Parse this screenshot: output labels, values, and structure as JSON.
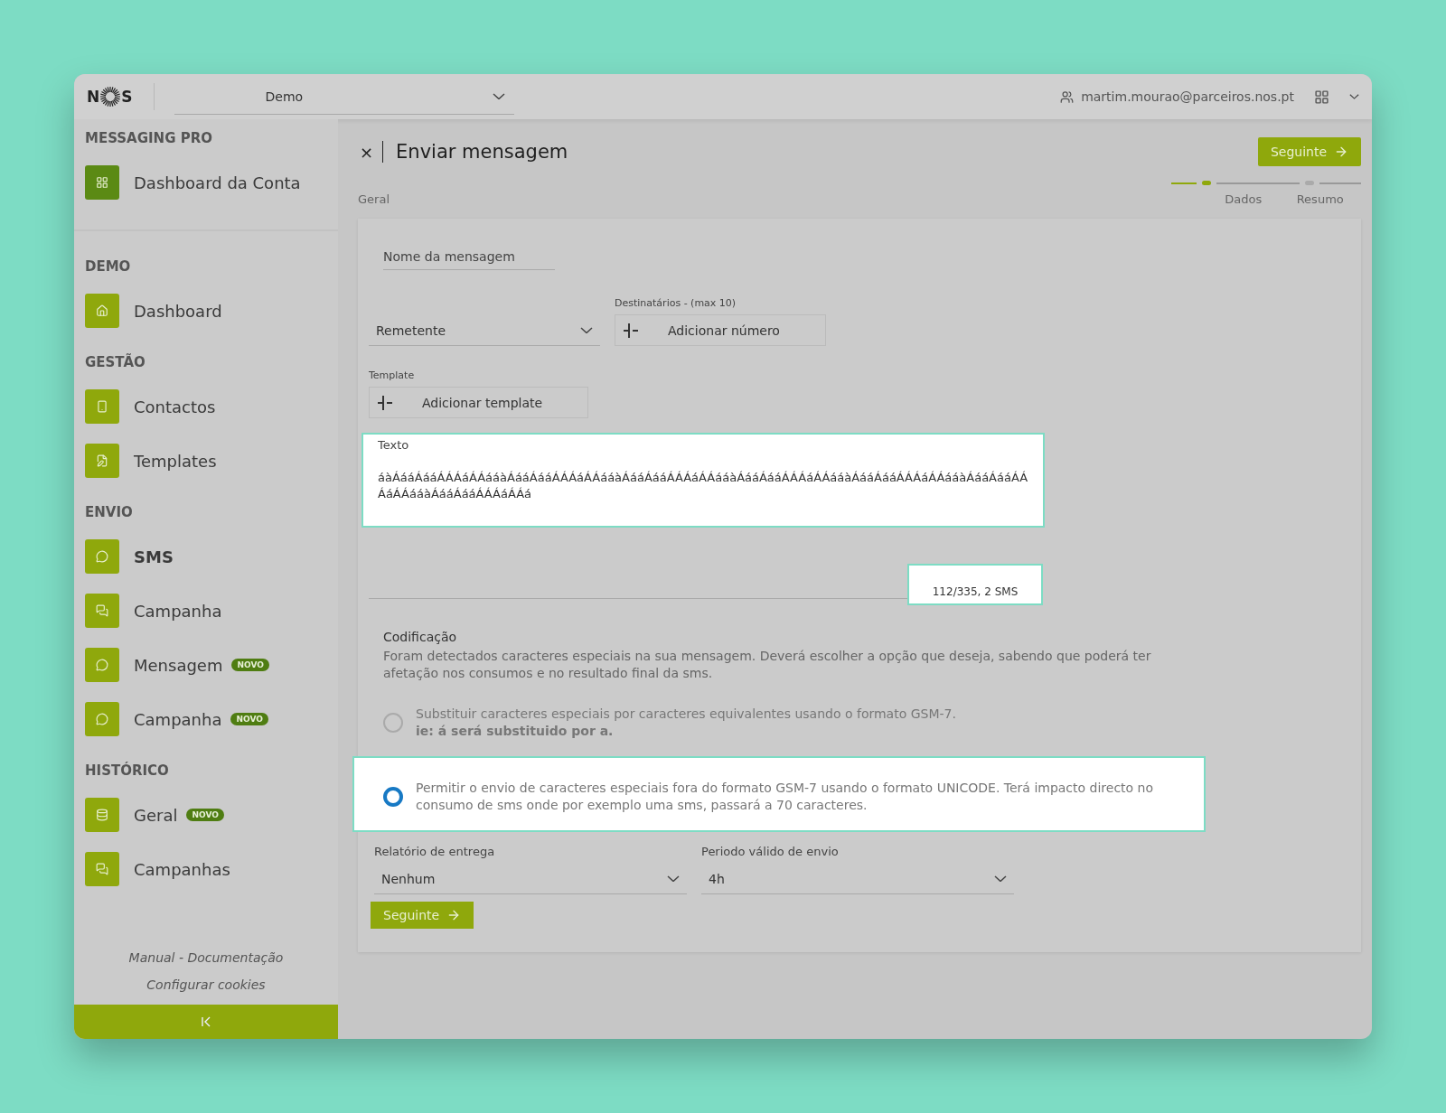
{
  "topbar": {
    "logo": {
      "left": "N",
      "right": "S"
    },
    "account_select": {
      "value": "Demo"
    },
    "user": "martim.mourao@parceiros.nos.pt"
  },
  "sidebar": {
    "sections": [
      {
        "title": "MESSAGING PRO",
        "kind": "account",
        "items": [
          {
            "label": "Dashboard da Conta",
            "selected": false
          }
        ]
      },
      {
        "title": "DEMO",
        "kind": "nav",
        "items": [
          {
            "label": "Dashboard",
            "selected": false
          }
        ]
      },
      {
        "title": "GESTÃO",
        "kind": "nav",
        "items": [
          {
            "label": "Contactos",
            "selected": false
          },
          {
            "label": "Templates",
            "selected": false
          }
        ]
      },
      {
        "title": "ENVIO",
        "kind": "nav",
        "items": [
          {
            "label": "SMS",
            "selected": true
          },
          {
            "label": "Campanha",
            "selected": false
          },
          {
            "label": "Mensagem",
            "badge": "NOVO",
            "selected": false
          },
          {
            "label": "Campanha",
            "badge": "NOVO",
            "selected": false
          }
        ]
      },
      {
        "title": "HISTÓRICO",
        "kind": "nav",
        "items": [
          {
            "label": "Geral",
            "badge": "NOVO",
            "selected": false
          },
          {
            "label": "Campanhas",
            "selected": false
          }
        ]
      }
    ],
    "footer_links": [
      "Manual - Documentação",
      "Configurar cookies"
    ]
  },
  "main": {
    "close": "×",
    "title": "Enviar mensagem",
    "breadcrumb": "Geral",
    "next_button": "Seguinte",
    "stepper": [
      {
        "label": "Dados",
        "selected": true
      },
      {
        "label": "Resumo",
        "selected": false
      }
    ],
    "form": {
      "name_field": {
        "placeholder": "Nome da mensagem"
      },
      "sender_select": {
        "placeholder": "Remetente"
      },
      "recipients": {
        "label": "Destinatários - (max 10)",
        "button": "Adicionar número"
      },
      "template": {
        "label": "Template",
        "button": "Adicionar template"
      },
      "text": {
        "label": "Texto",
        "value": "áàÁááÁááÁÁÁáÁÁááàÁááÁááÁÁÁáÁÁááàÁááÁááÁÁÁáÁÁááàÁááÁááÁÁÁáÁÁááàÁááÁááÁÁÁáÁÁááàÁááÁááÁÁÁáÁÁááàÁááÁááÁÁÁáÁÁá",
        "highlighted": true
      },
      "counter": {
        "text": "112/335, 2 SMS",
        "highlighted": true
      },
      "encoding": {
        "title": "Codificação",
        "description": "Foram detectados caracteres especiais na sua mensagem. Deverá escolher a opção que deseja, sabendo que poderá ter afetação nos consumos e no resultado final da sms.",
        "options": [
          {
            "text": "Substituir caracteres especiais por caracteres equivalentes usando o formato GSM-7.",
            "note": "ie: á será substituido por a.",
            "selected": false,
            "highlighted": false
          },
          {
            "text": "Permitir o envio de caracteres especiais fora do formato GSM-7 usando o formato UNICODE. Terá impacto directo no consumo de sms onde por exemplo uma sms, passará a 70 caracteres.",
            "selected": true,
            "highlighted": true
          }
        ]
      },
      "selects": [
        {
          "label": "Relatório de entrega",
          "value": "Nenhum"
        },
        {
          "label": "Periodo válido de envio",
          "value": "4h"
        }
      ],
      "submit": "Seguinte"
    }
  }
}
